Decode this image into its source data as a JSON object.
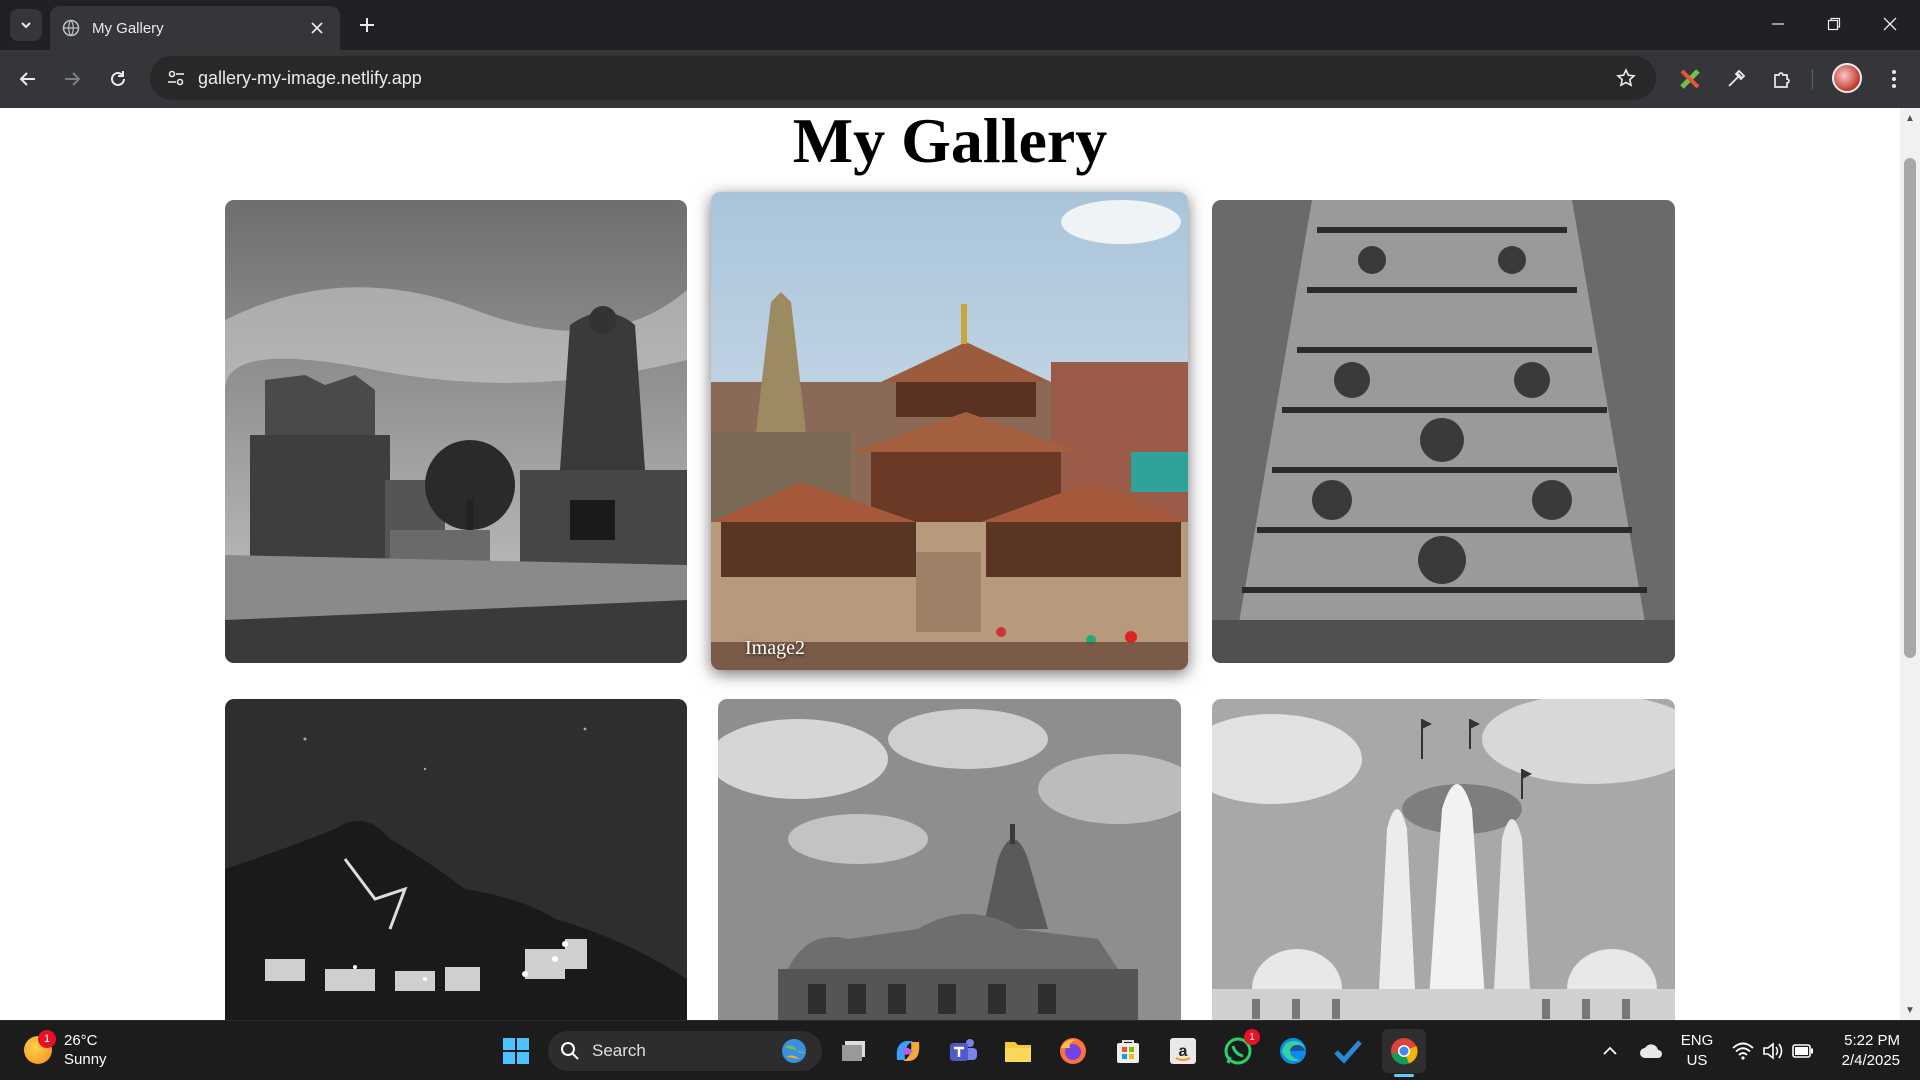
{
  "browser": {
    "tab_title": "My Gallery",
    "url": "gallery-my-image.netlify.app"
  },
  "page": {
    "title": "My Gallery",
    "images": [
      {
        "caption": "",
        "style": "grayscale"
      },
      {
        "caption": "Image2",
        "style": "color",
        "state": "hovered"
      },
      {
        "caption": "",
        "style": "grayscale"
      },
      {
        "caption": "",
        "style": "grayscale"
      },
      {
        "caption": "",
        "style": "grayscale"
      },
      {
        "caption": "",
        "style": "grayscale"
      }
    ]
  },
  "taskbar": {
    "weather_temp": "26°C",
    "weather_desc": "Sunny",
    "weather_badge": "1",
    "search_label": "Search",
    "whatsapp_badge": "1",
    "lang_line1": "ENG",
    "lang_line2": "US",
    "time": "5:22 PM",
    "date": "2/4/2025",
    "pinned": [
      "task-view",
      "copilot",
      "teams",
      "file-explorer",
      "firefox",
      "microsoft-store",
      "amazon",
      "whatsapp",
      "edge",
      "todo",
      "chrome"
    ]
  },
  "colors": {
    "chrome_dark": "#202124",
    "chrome_toolbar": "#35363a",
    "taskbar_bg": "#1c1c1c",
    "accent_blue": "#60cdff"
  }
}
